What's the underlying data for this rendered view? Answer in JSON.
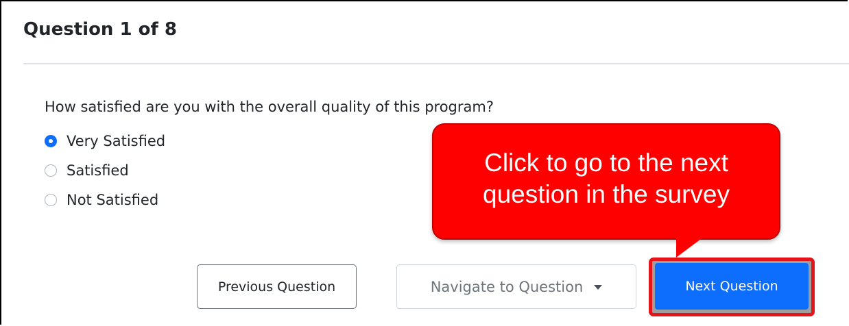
{
  "header": {
    "title": "Question 1 of 8"
  },
  "question": {
    "text": "How satisfied are you with the overall quality of this program?",
    "options": [
      {
        "label": "Very Satisfied",
        "selected": true
      },
      {
        "label": "Satisfied",
        "selected": false
      },
      {
        "label": "Not Satisfied",
        "selected": false
      }
    ]
  },
  "buttons": {
    "previous_label": "Previous Question",
    "navigate_label": "Navigate to Question",
    "next_label": "Next Question"
  },
  "callout": {
    "line1": "Click to go to the next",
    "line2": "question in the survey"
  },
  "colors": {
    "primary": "#0d6efd",
    "callout": "#ff0000",
    "highlight_border": "#e4141b"
  },
  "icons": {
    "navigate_caret": "chevron-down-icon"
  }
}
